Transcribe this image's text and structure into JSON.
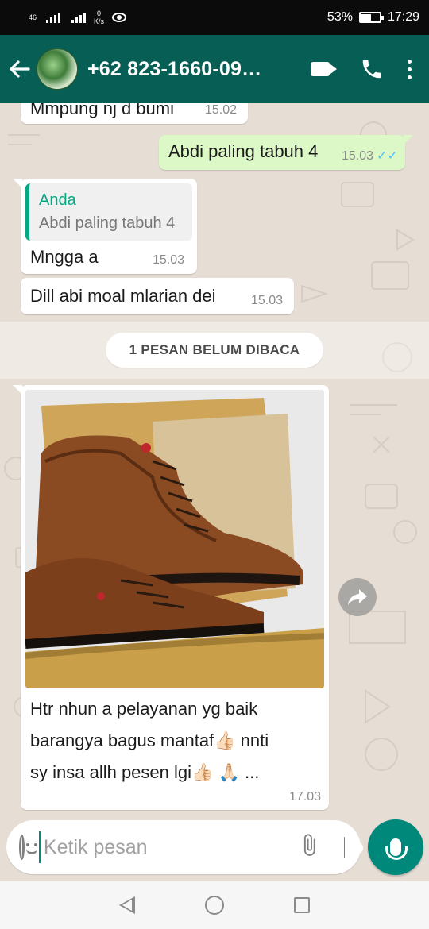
{
  "status_bar": {
    "signal1_label": "46",
    "speed_value": "0",
    "speed_unit": "K/s",
    "battery": "53%",
    "time": "17:29"
  },
  "header": {
    "contact_name": "+62 823-1660-09…",
    "back_icon": "arrow-left-icon",
    "video_icon": "video-camera-icon",
    "call_icon": "phone-icon",
    "menu_icon": "more-vert-icon"
  },
  "messages": [
    {
      "direction": "in",
      "text": "Mmpung nj d bumi",
      "time": "15.02"
    },
    {
      "direction": "out",
      "text": "Abdi paling tabuh 4",
      "time": "15.03",
      "status": "read"
    },
    {
      "direction": "in",
      "quote_author": "Anda",
      "quote_text": "Abdi paling tabuh 4",
      "text": "Mngga a",
      "time": "15.03"
    },
    {
      "direction": "in",
      "text": "Dill abi moal mlarian dei",
      "time": "15.03"
    }
  ],
  "unread_banner": "1 PESAN BELUM DIBACA",
  "image_message": {
    "caption_line1": "Htr nhun a pelayanan yg baik",
    "caption_line2": "barangya bagus mantaf👍🏻 nnti",
    "caption_line3": "sy insa allh pesen lgi👍🏻 🙏🏻 ...",
    "time": "17.03"
  },
  "composer": {
    "placeholder": "Ketik pesan",
    "emoji_icon": "emoji-icon",
    "attach_icon": "paperclip-icon",
    "camera_icon": "camera-icon",
    "mic_icon": "mic-icon"
  },
  "colors": {
    "header": "#075e54",
    "outgoing_bubble": "#dcf8c6",
    "accent": "#00897b",
    "read_ticks": "#4fc3f7"
  }
}
